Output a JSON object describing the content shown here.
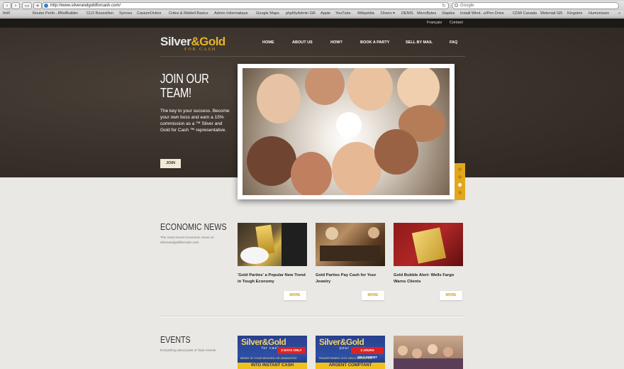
{
  "browser": {
    "back_icon": "chevron-left-icon",
    "forward_icon": "chevron-right-icon",
    "url": "http://www.silverandgoldforcash.com/",
    "search_placeholder": "Google",
    "bookmarks": [
      "fmR",
      "Router Perfo...lfNotBuilder",
      "CLD Roussillon",
      "Synnex",
      "CasiumOnline",
      "Crites & Riddell Basics",
      "Admin Informatique",
      "Google Maps",
      "phpMyAdmin GR",
      "Apple",
      "YouTube",
      "Wikipédia",
      "Divers ▾",
      "DENIS",
      "MicroBytes",
      "Staples",
      "Install Wind...o/Pen Drive",
      "CDW Canada",
      "Webmail GR",
      "Kingston",
      "Humorisses",
      "»"
    ]
  },
  "site": {
    "top_links": [
      "Français",
      "Contact"
    ],
    "logo": {
      "brand_silver": "Silver",
      "brand_amp": "&",
      "brand_gold": "Gold",
      "brand_sub": "FOR CASH"
    },
    "nav": [
      "HOME",
      "ABOUT US",
      "HOW?",
      "BOOK A PARTY",
      "SELL BY MAIL",
      "FAQ"
    ],
    "hero": {
      "title": "JOIN OUR TEAM!",
      "text": "The key to your success. Become your own boss and earn a 15% commission as a ™ Silver and Gold for Cash ™ representative.",
      "button": "JOIN",
      "slider_dots": 4,
      "active_dot": 3
    },
    "economic_news": {
      "title": "ECONOMIC NEWS",
      "subtitle": "The most recent economic news on silverandgoldforcash.com",
      "items": [
        {
          "title": "'Gold Parties' a Popular New Trend in Tough Economy",
          "more": "MORE"
        },
        {
          "title": "Gold Parties Pay Cash for Your Jewelry",
          "more": "MORE"
        },
        {
          "title": "Gold Bubble Alert: Wells Fargo Warns Clients",
          "more": "MORE"
        }
      ]
    },
    "events": {
      "title": "EVENTS",
      "subtitle": "Everything about past or futur events",
      "banners": [
        {
          "logo": "Silver&Gold",
          "sub": "for cash",
          "badge": "2 DAYS ONLY",
          "line": "BRING IN YOUR BROKEN OR UNWANTED",
          "bottom": "INTO INSTANT CASH"
        },
        {
          "logo": "Silver&Gold",
          "sub": "pour argent",
          "badge": "3 JOURS SEULEMENT",
          "line": "TRANSFORMEZ VOS VIEUX BIJOUX EN",
          "bottom": "ARGENT COMPTANT"
        }
      ]
    },
    "colors": {
      "accent": "#e2a81c",
      "hero_bg": "#3a322b",
      "topbar": "#1c1a17",
      "page_bg": "#e9e8e5"
    }
  }
}
